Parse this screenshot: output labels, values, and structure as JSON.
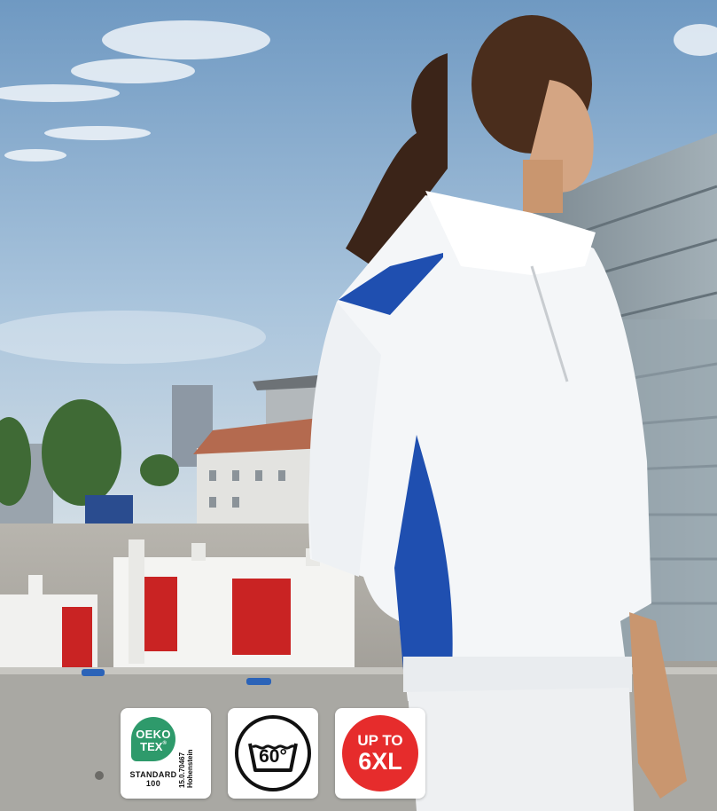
{
  "badges": {
    "oeko": {
      "line1": "OEKO",
      "line2": "TEX",
      "registered": "®",
      "standard_line1": "STANDARD",
      "standard_line2": "100",
      "cert_number": "15.0.70467",
      "institute": "Hohenstein",
      "color": "#2e9a6b"
    },
    "wash": {
      "temperature": "60°",
      "icon": "wash-60-icon"
    },
    "size": {
      "line1": "UP TO",
      "line2": "6XL",
      "color": "#e62c2c"
    }
  },
  "colors": {
    "sky": "#a9c4dc",
    "sweatshirt_white": "#f4f6f8",
    "accent_blue": "#1f4fb0",
    "barrier_red": "#c92323"
  }
}
